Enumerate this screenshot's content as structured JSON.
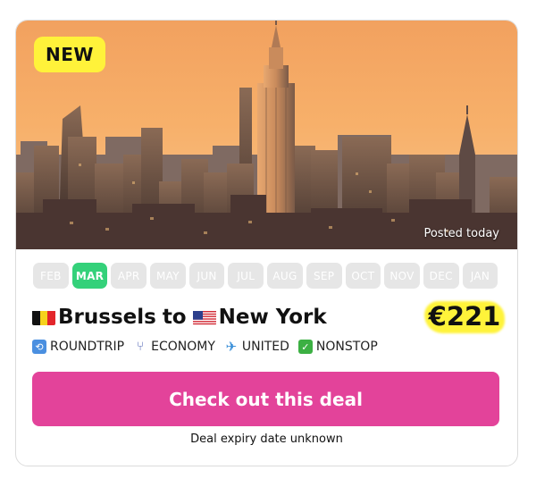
{
  "hero": {
    "badge": "NEW",
    "posted": "Posted today",
    "image_icon": "city-skyline"
  },
  "months": [
    "FEB",
    "MAR",
    "APR",
    "MAY",
    "JUN",
    "JUL",
    "AUG",
    "SEP",
    "OCT",
    "NOV",
    "DEC",
    "JAN"
  ],
  "selected_month": "MAR",
  "route": {
    "origin": "Brussels",
    "connector": "to",
    "destination": "New York",
    "origin_flag_icon": "belgium-flag-icon",
    "destination_flag_icon": "usa-flag-icon"
  },
  "price": "€221",
  "tags": [
    {
      "label": "ROUNDTRIP",
      "icon": "roundtrip-icon"
    },
    {
      "label": "ECONOMY",
      "icon": "seat-icon"
    },
    {
      "label": "UNITED",
      "icon": "airplane-icon"
    },
    {
      "label": "NONSTOP",
      "icon": "checkmark-icon"
    }
  ],
  "cta": "Check out this deal",
  "expiry": "Deal expiry date unknown",
  "colors": {
    "badge": "#fff23a",
    "month_active": "#34d17a",
    "month_inactive": "#e6e6e6",
    "cta": "#e3439a",
    "price_highlight": "#fff33a"
  }
}
